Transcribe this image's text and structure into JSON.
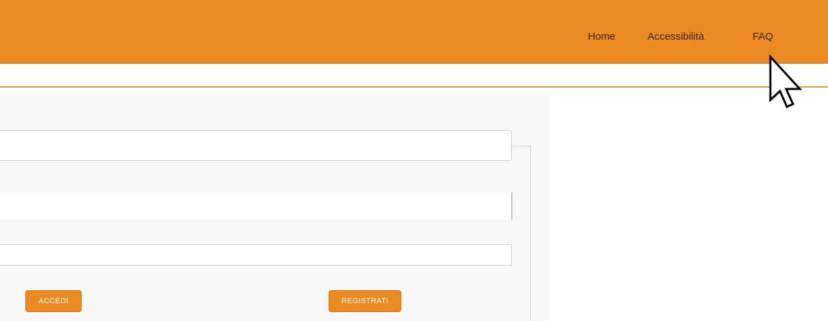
{
  "header": {
    "nav": {
      "home": "Home",
      "accessibility": "Accessibilità",
      "faq": "FAQ"
    }
  },
  "form": {
    "field1_value": "",
    "field2_value": "",
    "field3_value": "",
    "login_button": "ACCEDI",
    "register_button": "REGISTRATI"
  },
  "colors": {
    "header_bg": "#ec8a22",
    "accent_line": "#ec9a3c",
    "button_bg": "#ec8a22",
    "panel_bg": "#f8f8f8"
  },
  "icons": {
    "cursor": "mouse-pointer-icon"
  }
}
